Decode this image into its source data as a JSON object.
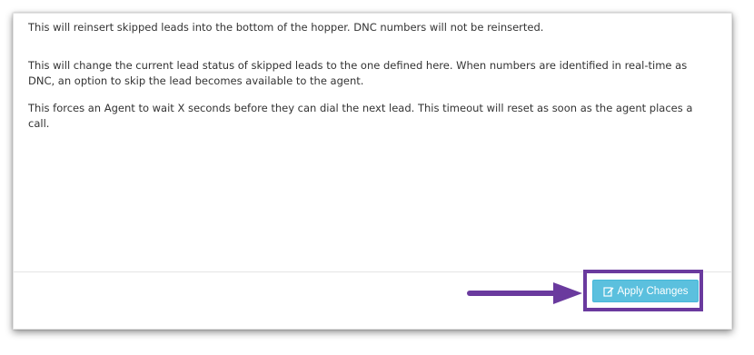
{
  "help_texts": {
    "reinsert": "This will reinsert skipped leads into the bottom of the hopper. DNC numbers will not be reinserted.",
    "status": "This will change the current lead status of skipped leads to the one defined here. When numbers are identified in real-time as DNC, an option to skip the lead becomes available to the agent.",
    "wait": "This forces an Agent to wait X seconds before they can dial the next lead. This timeout will reset as soon as the agent places a call."
  },
  "footer": {
    "apply_label": "Apply Changes",
    "apply_icon": "edit-icon"
  },
  "annotation": {
    "highlight_color": "#6a3a9e",
    "arrow_color": "#6a3a9e"
  },
  "colors": {
    "button_bg": "#5bc0de",
    "text": "#333333"
  }
}
